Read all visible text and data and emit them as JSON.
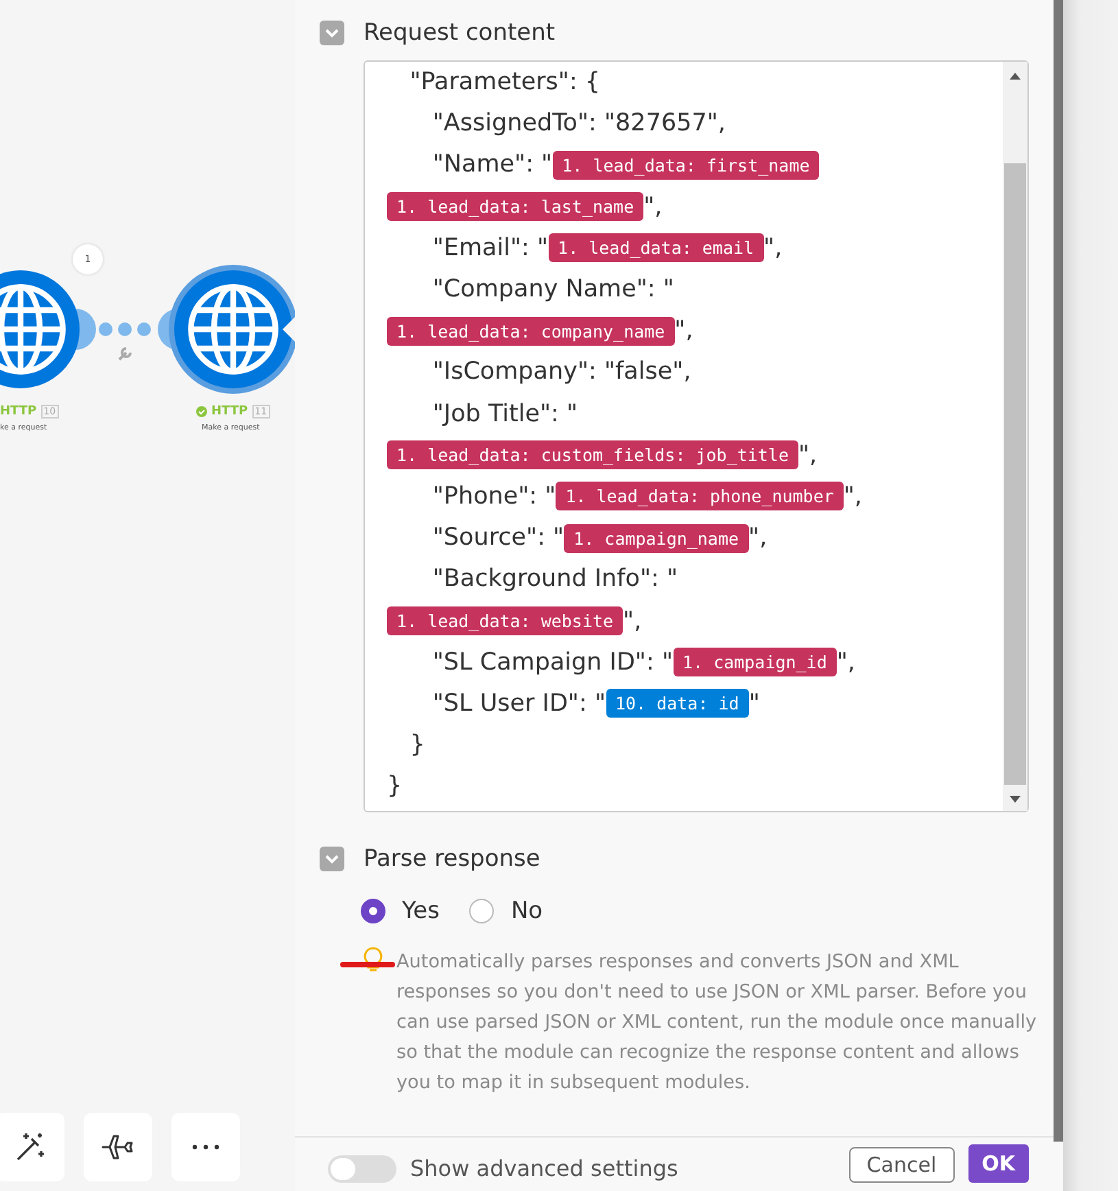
{
  "canvas": {
    "nodes": [
      {
        "name": "HTTP",
        "number": "10",
        "caption": "ke a request",
        "badge": "1",
        "status_ok": false
      },
      {
        "name": "HTTP",
        "number": "11",
        "caption": "Make a request",
        "status_ok": true
      }
    ],
    "toolbar": [
      {
        "kind": "wand"
      },
      {
        "kind": "plane"
      },
      {
        "kind": "more"
      }
    ]
  },
  "panel": {
    "request_content": {
      "title": "Request content",
      "expanded": true,
      "lines": [
        [
          {
            "kind": "text",
            "text": "   \"Parameters\": {"
          }
        ],
        [
          {
            "kind": "text",
            "text": "      \"AssignedTo\": \"827657\","
          }
        ],
        [
          {
            "kind": "text",
            "text": "      \"Name\": \""
          },
          {
            "kind": "pill",
            "text": "1. lead_data: first_name",
            "color": "#c6335d"
          }
        ],
        [
          {
            "kind": "pill",
            "text": "1. lead_data: last_name",
            "color": "#c6335d"
          },
          {
            "kind": "text",
            "text": "\","
          }
        ],
        [
          {
            "kind": "text",
            "text": "      \"Email\": \""
          },
          {
            "kind": "pill",
            "text": "1. lead_data: email",
            "color": "#c6335d"
          },
          {
            "kind": "text",
            "text": "\","
          }
        ],
        [
          {
            "kind": "text",
            "text": "      \"Company Name\": \""
          }
        ],
        [
          {
            "kind": "pill",
            "text": "1. lead_data: company_name",
            "color": "#c6335d"
          },
          {
            "kind": "text",
            "text": "\","
          }
        ],
        [
          {
            "kind": "text",
            "text": "      \"IsCompany\": \"false\","
          }
        ],
        [
          {
            "kind": "text",
            "text": "      \"Job Title\": \""
          }
        ],
        [
          {
            "kind": "pill",
            "text": "1. lead_data: custom_fields: job_title",
            "color": "#c6335d"
          },
          {
            "kind": "text",
            "text": "\","
          }
        ],
        [
          {
            "kind": "text",
            "text": "      \"Phone\": \""
          },
          {
            "kind": "pill",
            "text": "1. lead_data: phone_number",
            "color": "#c6335d"
          },
          {
            "kind": "text",
            "text": "\","
          }
        ],
        [
          {
            "kind": "text",
            "text": "      \"Source\": \""
          },
          {
            "kind": "pill",
            "text": "1. campaign_name",
            "color": "#c6335d"
          },
          {
            "kind": "text",
            "text": "\","
          }
        ],
        [
          {
            "kind": "text",
            "text": "      \"Background Info\": \""
          }
        ],
        [
          {
            "kind": "pill",
            "text": "1. lead_data: website",
            "color": "#c6335d"
          },
          {
            "kind": "text",
            "text": "\","
          }
        ],
        [
          {
            "kind": "text",
            "text": "      \"SL Campaign ID\": \""
          },
          {
            "kind": "pill",
            "text": "1. campaign_id",
            "color": "#c6335d"
          },
          {
            "kind": "text",
            "text": "\","
          }
        ],
        [
          {
            "kind": "text",
            "text": "      \"SL User ID\": \""
          },
          {
            "kind": "pill",
            "text": "10. data: id",
            "color": "#0080d8"
          },
          {
            "kind": "text",
            "text": "\""
          }
        ],
        [
          {
            "kind": "text",
            "text": "   }"
          }
        ],
        [
          {
            "kind": "text",
            "text": "}"
          }
        ]
      ]
    },
    "parse_response": {
      "title": "Parse response",
      "expanded": true,
      "options": [
        {
          "label": "Yes",
          "selected": true
        },
        {
          "label": "No",
          "selected": false
        }
      ],
      "hint": "Automatically parses responses and converts JSON and XML responses so you don't need to use JSON or XML parser. Before you can use parsed JSON or XML content, run the module once manually so that the module can recognize the response content and allows you to map it in subsequent modules."
    },
    "footer": {
      "advanced_label": "Show advanced settings",
      "advanced_on": false,
      "cancel": "Cancel",
      "ok": "OK"
    }
  }
}
